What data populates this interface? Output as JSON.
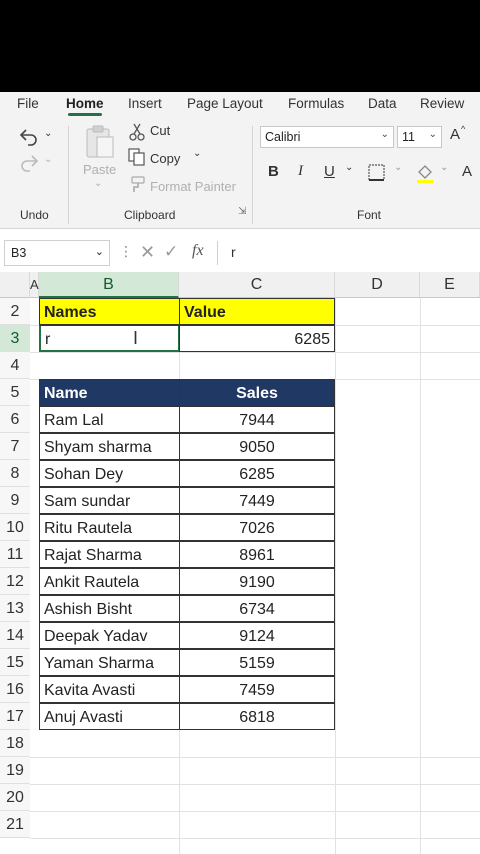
{
  "menu": {
    "tabs": [
      "File",
      "Home",
      "Insert",
      "Page Layout",
      "Formulas",
      "Data",
      "Review"
    ],
    "active": "Home"
  },
  "ribbon": {
    "undo_label": "Undo",
    "clipboard_label": "Clipboard",
    "paste_label": "Paste",
    "cut_label": "Cut",
    "copy_label": "Copy",
    "format_painter_label": "Format Painter",
    "font_label": "Font",
    "font_name": "Calibri",
    "font_size": "11",
    "bold": "B",
    "italic": "I",
    "underline": "U",
    "grow_font": "A",
    "font_color": "A"
  },
  "formula_bar": {
    "name_box": "B3",
    "fx": "fx",
    "content": "r"
  },
  "grid": {
    "columns": [
      "A",
      "B",
      "C",
      "D",
      "E"
    ],
    "selected_column": "B",
    "rows": [
      "2",
      "3",
      "4",
      "5",
      "6",
      "7",
      "8",
      "9",
      "10",
      "11",
      "12",
      "13",
      "14",
      "15",
      "16",
      "17",
      "18",
      "19",
      "20",
      "21"
    ],
    "selected_row": "3"
  },
  "lookup": {
    "header_names": "Names",
    "header_value": "Value",
    "input": "r",
    "result": "6285"
  },
  "table": {
    "header_name": "Name",
    "header_sales": "Sales",
    "rows": [
      {
        "name": "Ram Lal",
        "sales": "7944"
      },
      {
        "name": "Shyam sharma",
        "sales": "9050"
      },
      {
        "name": "Sohan Dey",
        "sales": "6285"
      },
      {
        "name": "Sam sundar",
        "sales": "7449"
      },
      {
        "name": "Ritu Rautela",
        "sales": "7026"
      },
      {
        "name": "Rajat Sharma",
        "sales": "8961"
      },
      {
        "name": "Ankit Rautela",
        "sales": "9190"
      },
      {
        "name": "Ashish Bisht",
        "sales": "6734"
      },
      {
        "name": "Deepak Yadav",
        "sales": "9124"
      },
      {
        "name": "Yaman Sharma",
        "sales": "5159"
      },
      {
        "name": "Kavita Avasti",
        "sales": "7459"
      },
      {
        "name": "Anuj Avasti",
        "sales": "6818"
      }
    ]
  },
  "colors": {
    "accent": "#217346",
    "header_yellow": "#ffff00",
    "header_navy": "#203864"
  }
}
